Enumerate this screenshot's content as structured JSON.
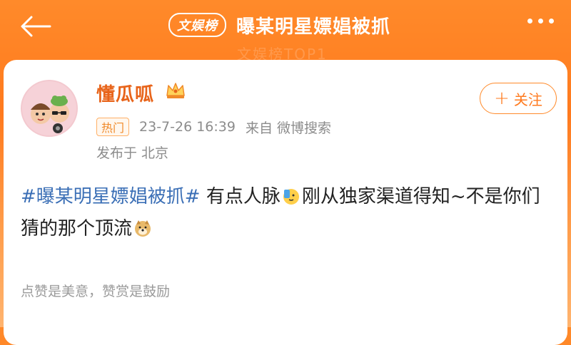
{
  "header": {
    "badge": "文娱榜",
    "title": "曝某明星嫖娼被抓",
    "faint_text": "文娱榜TOP1"
  },
  "post": {
    "username": "懂瓜呱",
    "follow_label": "关注",
    "hot_tag": "热门",
    "timestamp": "23-7-26 16:39",
    "source": "来自 微博搜索",
    "location": "发布于 北京",
    "hashtag": "#曝某明星嫖娼被抓#",
    "text_part1": " 有点人脉",
    "text_part2": "刚从独家渠道得知~不是你们猜的那个顶流",
    "footer": "点赞是美意，赞赏是鼓励"
  },
  "icons": {
    "back": "back-arrow-icon",
    "more": "more-dots-icon",
    "crown": "crown-icon",
    "emoji1": "phone-call-emoji",
    "emoji2": "doge-emoji"
  },
  "colors": {
    "accent": "#ff7a1e",
    "username": "#e8641a",
    "hashtag": "#3b6fb6"
  }
}
